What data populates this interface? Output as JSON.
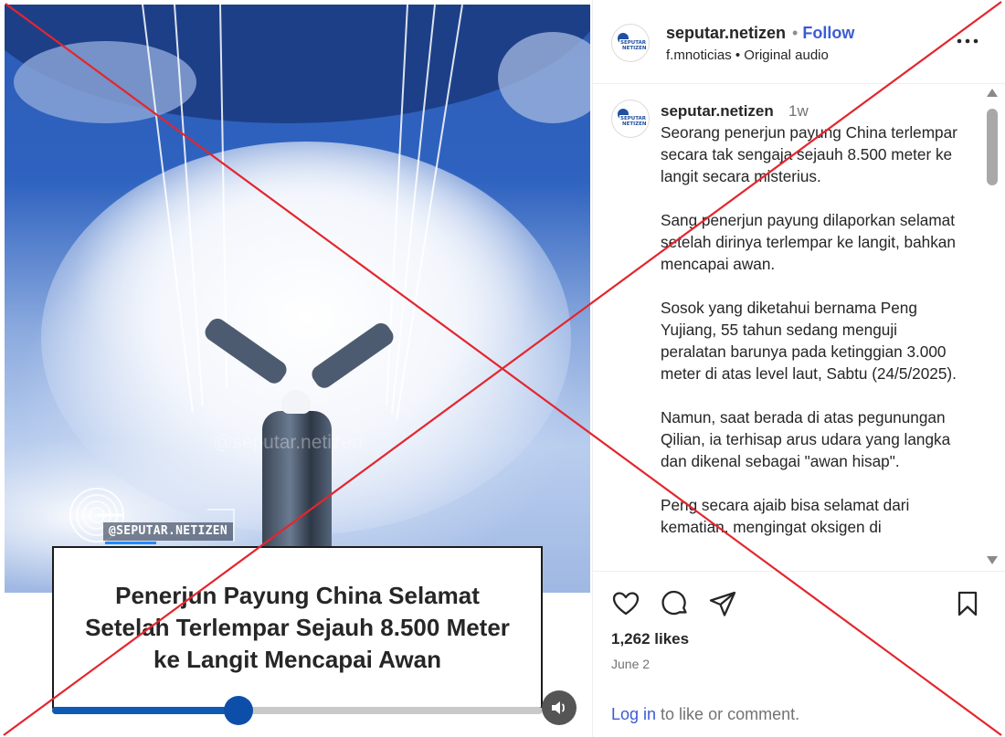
{
  "post": {
    "username": "seputar.netizen",
    "dot": "•",
    "follow_label": "Follow",
    "audio": "f.mnoticias • Original audio",
    "avatar_text_1": "SEPUTAR",
    "avatar_text_2": "NETIZEN"
  },
  "media": {
    "watermark": "@seputar.netizen",
    "brand_handle": "@SEPUTAR.NETIZEN",
    "headline": "Penerjun Payung China Selamat Setelah Terlempar Sejauh 8.500 Meter ke Langit Mencapai Awan",
    "progress_fraction": 0.379,
    "volume_icon": "volume-icon"
  },
  "caption": {
    "username": "seputar.netizen",
    "time": "1w",
    "paragraphs": [
      "Seorang penerjun payung China terlempar secara tak sengaja sejauh 8.500 meter ke langit secara misterius.",
      "Sang penerjun payung dilaporkan selamat setelah dirinya terlempar ke langit, bahkan mencapai awan.",
      "Sosok yang diketahui bernama Peng Yujiang, 55 tahun sedang menguji peralatan barunya pada ketinggian 3.000 meter di atas level laut, Sabtu (24/5/2025).",
      "Namun, saat berada di atas pegunungan Qilian, ia terhisap arus udara yang langka dan dikenal sebagai \"awan hisap\".",
      "Peng secara ajaib bisa selamat dari kematian, mengingat oksigen di"
    ]
  },
  "actions": {
    "icons": [
      "heart-icon",
      "comment-icon",
      "share-icon",
      "bookmark-icon"
    ],
    "likes": "1,262 likes",
    "date": "June 2",
    "login_link": "Log in",
    "login_rest": " to like or comment."
  },
  "colors": {
    "overlay_cross": "#e3262e",
    "link_blue": "#3b5bd8",
    "progress_blue": "#0d5bb5"
  }
}
